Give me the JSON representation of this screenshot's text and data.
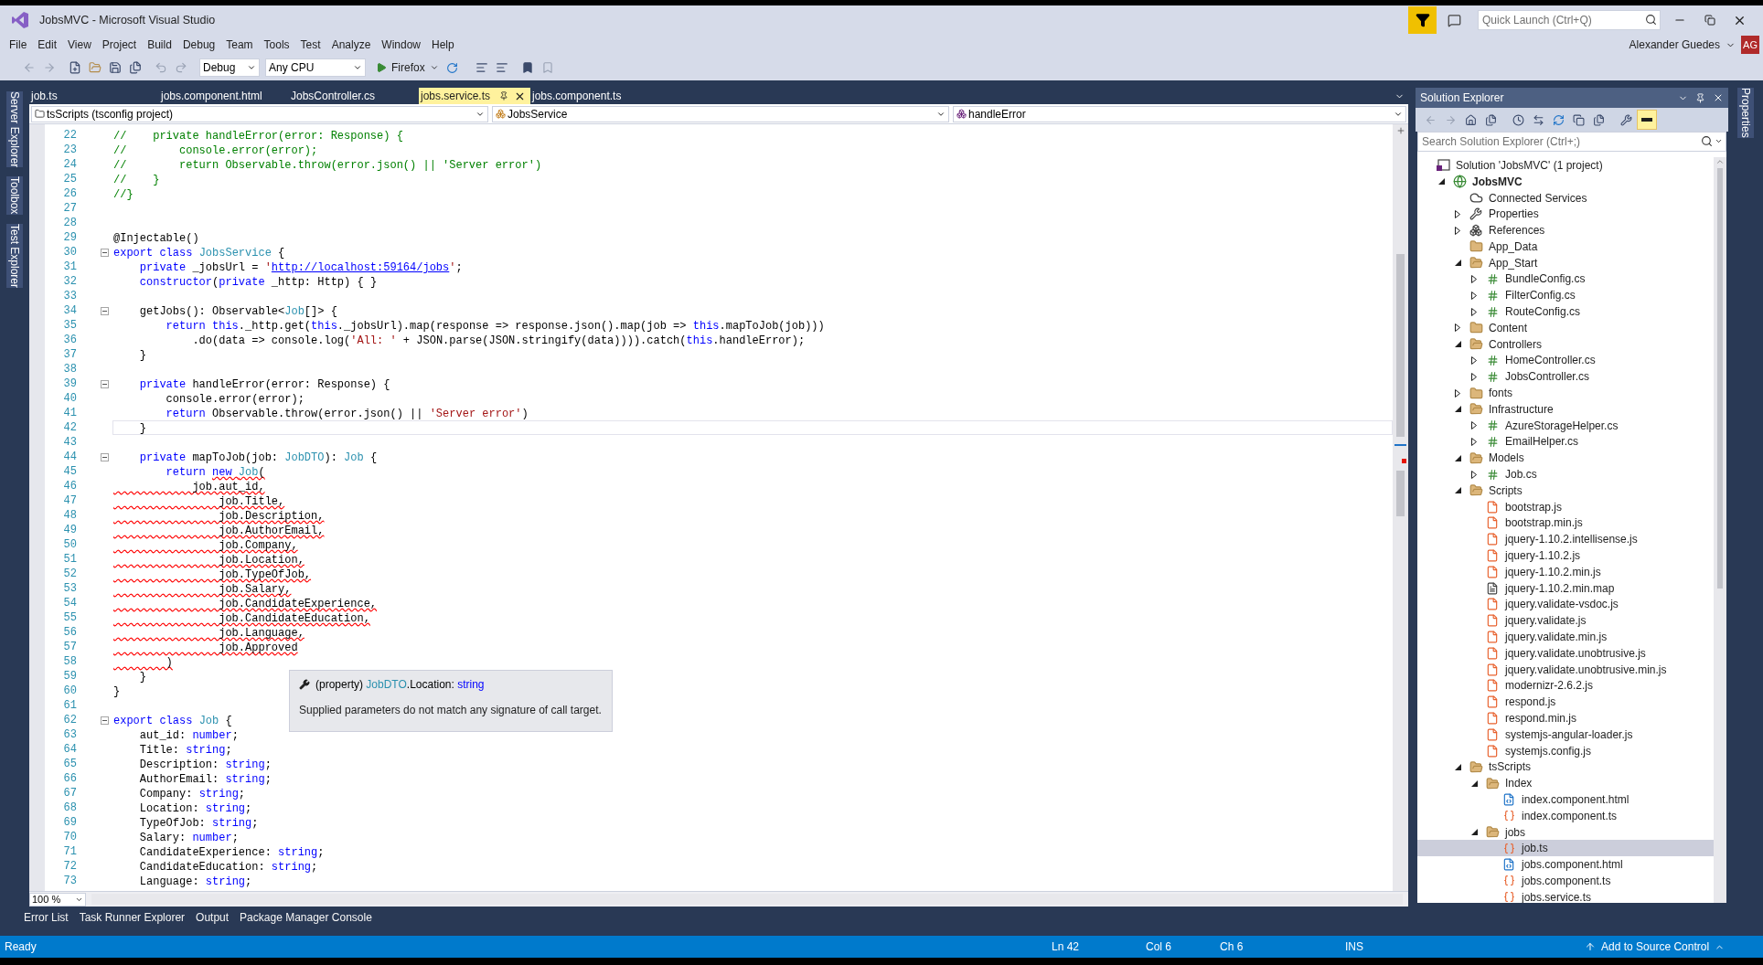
{
  "window": {
    "title": "JobsMVC - Microsoft Visual Studio"
  },
  "quick_launch": {
    "placeholder": "Quick Launch (Ctrl+Q)"
  },
  "menu": [
    "File",
    "Edit",
    "View",
    "Project",
    "Build",
    "Debug",
    "Team",
    "Tools",
    "Test",
    "Analyze",
    "Window",
    "Help"
  ],
  "account": {
    "name": "Alexander Guedes",
    "initials": "AG"
  },
  "toolbar": {
    "configuration": "Debug",
    "platform": "Any CPU",
    "run_target": "Firefox"
  },
  "left_tool_tabs": [
    "Server Explorer",
    "Toolbox",
    "Test Explorer"
  ],
  "right_tool_tabs": [
    "Properties"
  ],
  "document_tabs": [
    {
      "label": "job.ts",
      "selected": false
    },
    {
      "label": "jobs.component.html",
      "selected": false
    },
    {
      "label": "JobsController.cs",
      "selected": false
    },
    {
      "label": "jobs.service.ts",
      "selected": true
    },
    {
      "label": "jobs.component.ts",
      "selected": false
    }
  ],
  "navigation_bar": {
    "project": "tsScripts (tsconfig project)",
    "type": "JobsService",
    "member": "handleError"
  },
  "editor": {
    "lines": [
      {
        "n": "22",
        "fold": false,
        "current": false,
        "segs": [
          {
            "text": "//    private handleError(error: Response) {",
            "kind": "comment"
          }
        ]
      },
      {
        "n": "23",
        "fold": false,
        "current": false,
        "segs": [
          {
            "text": "//        console.error(error);",
            "kind": "comment"
          }
        ]
      },
      {
        "n": "24",
        "fold": false,
        "current": false,
        "segs": [
          {
            "text": "//        return Observable.throw(error.json() || 'Server error')",
            "kind": "comment"
          }
        ]
      },
      {
        "n": "25",
        "fold": false,
        "current": false,
        "segs": [
          {
            "text": "//    }",
            "kind": "comment"
          }
        ]
      },
      {
        "n": "26",
        "fold": false,
        "current": false,
        "segs": [
          {
            "text": "//}",
            "kind": "comment"
          }
        ]
      },
      {
        "n": "27",
        "fold": false,
        "current": false
      },
      {
        "n": "28",
        "fold": false,
        "current": false
      },
      {
        "n": "29",
        "fold": false,
        "current": false,
        "segs": [
          {
            "text": "@Injectable()",
            "kind": "plain"
          }
        ]
      },
      {
        "n": "30",
        "fold": true,
        "current": false,
        "segs": [
          {
            "text": "export class ",
            "kind": "keyword"
          },
          {
            "text": "JobsService",
            "kind": "type"
          },
          {
            "text": " {",
            "kind": "plain"
          }
        ]
      },
      {
        "n": "31",
        "fold": false,
        "current": false,
        "segs": [
          {
            "text": "    private",
            "kind": "keyword"
          },
          {
            "text": " _jobsUrl = ",
            "kind": "plain"
          },
          {
            "text": "'",
            "kind": "string"
          },
          {
            "text": "http://localhost:59164/jobs",
            "kind": "link"
          },
          {
            "text": "'",
            "kind": "string"
          },
          {
            "text": ";",
            "kind": "plain"
          }
        ]
      },
      {
        "n": "32",
        "fold": false,
        "current": false,
        "segs": [
          {
            "text": "    constructor",
            "kind": "keyword"
          },
          {
            "text": "(",
            "kind": "plain"
          },
          {
            "text": "private",
            "kind": "keyword"
          },
          {
            "text": " _http: Http) { }",
            "kind": "plain"
          }
        ]
      },
      {
        "n": "33",
        "fold": false,
        "current": false
      },
      {
        "n": "34",
        "fold": true,
        "current": false,
        "segs": [
          {
            "text": "    getJobs(): Observable<",
            "kind": "plain"
          },
          {
            "text": "Job",
            "kind": "type"
          },
          {
            "text": "[]> {",
            "kind": "plain"
          }
        ]
      },
      {
        "n": "35",
        "fold": false,
        "current": false,
        "segs": [
          {
            "text": "        return this",
            "kind": "keyword"
          },
          {
            "text": "._http.get(",
            "kind": "plain"
          },
          {
            "text": "this",
            "kind": "keyword"
          },
          {
            "text": "._jobsUrl).map(response => response.json().map(job => ",
            "kind": "plain"
          },
          {
            "text": "this",
            "kind": "keyword"
          },
          {
            "text": ".mapToJob(job)))",
            "kind": "plain"
          }
        ]
      },
      {
        "n": "36",
        "fold": false,
        "current": false,
        "segs": [
          {
            "text": "            .do(data => console.log(",
            "kind": "plain"
          },
          {
            "text": "'All: '",
            "kind": "string"
          },
          {
            "text": " + JSON.parse(JSON.stringify(data)))).catch(",
            "kind": "plain"
          },
          {
            "text": "this",
            "kind": "keyword"
          },
          {
            "text": ".handleError);",
            "kind": "plain"
          }
        ]
      },
      {
        "n": "37",
        "fold": false,
        "current": false,
        "segs": [
          {
            "text": "    }",
            "kind": "plain"
          }
        ]
      },
      {
        "n": "38",
        "fold": false,
        "current": false
      },
      {
        "n": "39",
        "fold": true,
        "current": false,
        "segs": [
          {
            "text": "    private",
            "kind": "keyword"
          },
          {
            "text": " handleError(error: Response) {",
            "kind": "plain"
          }
        ]
      },
      {
        "n": "40",
        "fold": false,
        "current": false,
        "segs": [
          {
            "text": "        console.error(error);",
            "kind": "plain"
          }
        ]
      },
      {
        "n": "41",
        "fold": false,
        "current": false,
        "segs": [
          {
            "text": "        return",
            "kind": "keyword"
          },
          {
            "text": " Observable.throw(error.json() || ",
            "kind": "plain"
          },
          {
            "text": "'Server error'",
            "kind": "string"
          },
          {
            "text": ")",
            "kind": "plain"
          }
        ]
      },
      {
        "n": "42",
        "fold": false,
        "current": true,
        "segs": [
          {
            "text": "    }",
            "kind": "plain"
          }
        ]
      },
      {
        "n": "43",
        "fold": false,
        "current": false
      },
      {
        "n": "44",
        "fold": true,
        "current": false,
        "segs": [
          {
            "text": "    private",
            "kind": "keyword"
          },
          {
            "text": " mapToJob(job: ",
            "kind": "plain"
          },
          {
            "text": "JobDTO",
            "kind": "type"
          },
          {
            "text": "): ",
            "kind": "plain"
          },
          {
            "text": "Job",
            "kind": "type"
          },
          {
            "text": " {",
            "kind": "plain"
          }
        ]
      },
      {
        "n": "45",
        "fold": false,
        "current": false,
        "segs": [
          {
            "text": "        return ",
            "kind": "keyword"
          },
          {
            "text": "new ",
            "kind": "keyword",
            "error": true
          },
          {
            "text": "Job",
            "kind": "type",
            "error": true
          },
          {
            "text": "(",
            "kind": "plain",
            "error": true
          }
        ]
      },
      {
        "n": "46",
        "fold": false,
        "current": false,
        "segs": [
          {
            "text": "            job.aut_id,",
            "kind": "plain",
            "error": true
          }
        ]
      },
      {
        "n": "47",
        "fold": false,
        "current": false,
        "segs": [
          {
            "text": "                job.Title,",
            "kind": "plain",
            "error": true
          }
        ]
      },
      {
        "n": "48",
        "fold": false,
        "current": false,
        "segs": [
          {
            "text": "                job.Description,",
            "kind": "plain",
            "error": true
          }
        ]
      },
      {
        "n": "49",
        "fold": false,
        "current": false,
        "segs": [
          {
            "text": "                job.AuthorEmail,",
            "kind": "plain",
            "error": true
          }
        ]
      },
      {
        "n": "50",
        "fold": false,
        "current": false,
        "segs": [
          {
            "text": "                job.Company,",
            "kind": "plain",
            "error": true
          }
        ]
      },
      {
        "n": "51",
        "fold": false,
        "current": false,
        "segs": [
          {
            "text": "                job.Location,",
            "kind": "plain",
            "error": true
          }
        ]
      },
      {
        "n": "52",
        "fold": false,
        "current": false,
        "segs": [
          {
            "text": "                job.TypeOfJob,",
            "kind": "plain",
            "error": true
          }
        ]
      },
      {
        "n": "53",
        "fold": false,
        "current": false,
        "segs": [
          {
            "text": "                job.Salary,",
            "kind": "plain",
            "error": true
          }
        ]
      },
      {
        "n": "54",
        "fold": false,
        "current": false,
        "segs": [
          {
            "text": "                job.CandidateExperience,",
            "kind": "plain",
            "error": true
          }
        ]
      },
      {
        "n": "55",
        "fold": false,
        "current": false,
        "segs": [
          {
            "text": "                job.CandidateEducation,",
            "kind": "plain",
            "error": true
          }
        ]
      },
      {
        "n": "56",
        "fold": false,
        "current": false,
        "segs": [
          {
            "text": "                job.Language,",
            "kind": "plain",
            "error": true
          }
        ]
      },
      {
        "n": "57",
        "fold": false,
        "current": false,
        "segs": [
          {
            "text": "                job.Approved",
            "kind": "plain",
            "error": true
          }
        ]
      },
      {
        "n": "58",
        "fold": false,
        "current": false,
        "segs": [
          {
            "text": "        )",
            "kind": "plain",
            "error": true
          }
        ]
      },
      {
        "n": "59",
        "fold": false,
        "current": false,
        "segs": [
          {
            "text": "    }",
            "kind": "plain"
          }
        ]
      },
      {
        "n": "60",
        "fold": false,
        "current": false,
        "segs": [
          {
            "text": "}",
            "kind": "plain"
          }
        ]
      },
      {
        "n": "61",
        "fold": false,
        "current": false
      },
      {
        "n": "62",
        "fold": true,
        "current": false,
        "segs": [
          {
            "text": "export class ",
            "kind": "keyword"
          },
          {
            "text": "Job",
            "kind": "type"
          },
          {
            "text": " {",
            "kind": "plain"
          }
        ]
      },
      {
        "n": "63",
        "fold": false,
        "current": false,
        "segs": [
          {
            "text": "    aut_id: ",
            "kind": "plain"
          },
          {
            "text": "number",
            "kind": "keyword"
          },
          {
            "text": ";",
            "kind": "plain"
          }
        ]
      },
      {
        "n": "64",
        "fold": false,
        "current": false,
        "segs": [
          {
            "text": "    Title: ",
            "kind": "plain"
          },
          {
            "text": "string",
            "kind": "keyword"
          },
          {
            "text": ";",
            "kind": "plain"
          }
        ]
      },
      {
        "n": "65",
        "fold": false,
        "current": false,
        "segs": [
          {
            "text": "    Description: ",
            "kind": "plain"
          },
          {
            "text": "string",
            "kind": "keyword"
          },
          {
            "text": ";",
            "kind": "plain"
          }
        ]
      },
      {
        "n": "66",
        "fold": false,
        "current": false,
        "segs": [
          {
            "text": "    AuthorEmail: ",
            "kind": "plain"
          },
          {
            "text": "string",
            "kind": "keyword"
          },
          {
            "text": ";",
            "kind": "plain"
          }
        ]
      },
      {
        "n": "67",
        "fold": false,
        "current": false,
        "segs": [
          {
            "text": "    Company: ",
            "kind": "plain"
          },
          {
            "text": "string",
            "kind": "keyword"
          },
          {
            "text": ";",
            "kind": "plain"
          }
        ]
      },
      {
        "n": "68",
        "fold": false,
        "current": false,
        "segs": [
          {
            "text": "    Location: ",
            "kind": "plain"
          },
          {
            "text": "string",
            "kind": "keyword"
          },
          {
            "text": ";",
            "kind": "plain"
          }
        ]
      },
      {
        "n": "69",
        "fold": false,
        "current": false,
        "segs": [
          {
            "text": "    TypeOfJob: ",
            "kind": "plain"
          },
          {
            "text": "string",
            "kind": "keyword"
          },
          {
            "text": ";",
            "kind": "plain"
          }
        ]
      },
      {
        "n": "70",
        "fold": false,
        "current": false,
        "segs": [
          {
            "text": "    Salary: ",
            "kind": "plain"
          },
          {
            "text": "number",
            "kind": "keyword"
          },
          {
            "text": ";",
            "kind": "plain"
          }
        ]
      },
      {
        "n": "71",
        "fold": false,
        "current": false,
        "segs": [
          {
            "text": "    CandidateExperience: ",
            "kind": "plain"
          },
          {
            "text": "string",
            "kind": "keyword"
          },
          {
            "text": ";",
            "kind": "plain"
          }
        ]
      },
      {
        "n": "72",
        "fold": false,
        "current": false,
        "segs": [
          {
            "text": "    CandidateEducation: ",
            "kind": "plain"
          },
          {
            "text": "string",
            "kind": "keyword"
          },
          {
            "text": ";",
            "kind": "plain"
          }
        ]
      },
      {
        "n": "73",
        "fold": false,
        "current": false,
        "segs": [
          {
            "text": "    Language: ",
            "kind": "plain"
          },
          {
            "text": "string",
            "kind": "keyword"
          },
          {
            "text": ";",
            "kind": "plain"
          }
        ]
      }
    ],
    "tooltip": {
      "segs": [
        {
          "text": "(property) ",
          "kind": "plain"
        },
        {
          "text": "JobDTO",
          "kind": "type"
        },
        {
          "text": ".Location: ",
          "kind": "plain"
        },
        {
          "text": "string",
          "kind": "keyword"
        }
      ],
      "message": "Supplied parameters do not match any signature of call target."
    },
    "zoom": "100 %"
  },
  "tool_windows": [
    "Error List",
    "Task Runner Explorer",
    "Output",
    "Package Manager Console"
  ],
  "solution_explorer": {
    "title": "Solution Explorer",
    "search": {
      "placeholder": "Search Solution Explorer (Ctrl+;)"
    },
    "tree": [
      {
        "label": "Solution 'JobsMVC' (1 project)",
        "kind": "solution",
        "selected": false,
        "children": [
          {
            "label": "JobsMVC",
            "kind": "project",
            "expanded": true,
            "selected": false,
            "children": [
              {
                "label": "Connected Services",
                "kind": "cloud",
                "selected": false
              },
              {
                "label": "Properties",
                "kind": "wrench",
                "expanded": false,
                "selected": false
              },
              {
                "label": "References",
                "kind": "references",
                "expanded": false,
                "selected": false
              },
              {
                "label": "App_Data",
                "kind": "folder",
                "selected": false
              },
              {
                "label": "App_Start",
                "kind": "folder",
                "expanded": true,
                "selected": false,
                "children": [
                  {
                    "label": "BundleConfig.cs",
                    "kind": "cs",
                    "expanded": false,
                    "selected": false
                  },
                  {
                    "label": "FilterConfig.cs",
                    "kind": "cs",
                    "expanded": false,
                    "selected": false
                  },
                  {
                    "label": "RouteConfig.cs",
                    "kind": "cs",
                    "expanded": false,
                    "selected": false
                  }
                ]
              },
              {
                "label": "Content",
                "kind": "folder",
                "expanded": false,
                "selected": false
              },
              {
                "label": "Controllers",
                "kind": "folder",
                "expanded": true,
                "selected": false,
                "children": [
                  {
                    "label": "HomeController.cs",
                    "kind": "cs",
                    "expanded": false,
                    "selected": false
                  },
                  {
                    "label": "JobsController.cs",
                    "kind": "cs",
                    "expanded": false,
                    "selected": false
                  }
                ]
              },
              {
                "label": "fonts",
                "kind": "folder",
                "expanded": false,
                "selected": false
              },
              {
                "label": "Infrastructure",
                "kind": "folder",
                "expanded": true,
                "selected": false,
                "children": [
                  {
                    "label": "AzureStorageHelper.cs",
                    "kind": "cs",
                    "expanded": false,
                    "selected": false
                  },
                  {
                    "label": "EmailHelper.cs",
                    "kind": "cs",
                    "expanded": false,
                    "selected": false
                  }
                ]
              },
              {
                "label": "Models",
                "kind": "folder",
                "expanded": true,
                "selected": false,
                "children": [
                  {
                    "label": "Job.cs",
                    "kind": "cs",
                    "expanded": false,
                    "selected": false
                  }
                ]
              },
              {
                "label": "Scripts",
                "kind": "folder",
                "expanded": true,
                "selected": false,
                "children": [
                  {
                    "label": "bootstrap.js",
                    "kind": "js",
                    "selected": false
                  },
                  {
                    "label": "bootstrap.min.js",
                    "kind": "js",
                    "selected": false
                  },
                  {
                    "label": "jquery-1.10.2.intellisense.js",
                    "kind": "js",
                    "selected": false
                  },
                  {
                    "label": "jquery-1.10.2.js",
                    "kind": "js",
                    "selected": false
                  },
                  {
                    "label": "jquery-1.10.2.min.js",
                    "kind": "js",
                    "selected": false
                  },
                  {
                    "label": "jquery-1.10.2.min.map",
                    "kind": "text",
                    "selected": false
                  },
                  {
                    "label": "jquery.validate-vsdoc.js",
                    "kind": "js",
                    "selected": false
                  },
                  {
                    "label": "jquery.validate.js",
                    "kind": "js",
                    "selected": false
                  },
                  {
                    "label": "jquery.validate.min.js",
                    "kind": "js",
                    "selected": false
                  },
                  {
                    "label": "jquery.validate.unobtrusive.js",
                    "kind": "js",
                    "selected": false
                  },
                  {
                    "label": "jquery.validate.unobtrusive.min.js",
                    "kind": "js",
                    "selected": false
                  },
                  {
                    "label": "modernizr-2.6.2.js",
                    "kind": "js",
                    "selected": false
                  },
                  {
                    "label": "respond.js",
                    "kind": "js",
                    "selected": false
                  },
                  {
                    "label": "respond.min.js",
                    "kind": "js",
                    "selected": false
                  },
                  {
                    "label": "systemjs-angular-loader.js",
                    "kind": "js",
                    "selected": false
                  },
                  {
                    "label": "systemjs.config.js",
                    "kind": "js",
                    "selected": false
                  }
                ]
              },
              {
                "label": "tsScripts",
                "kind": "folder",
                "expanded": true,
                "selected": false,
                "children": [
                  {
                    "label": "Index",
                    "kind": "folder",
                    "expanded": true,
                    "selected": false,
                    "children": [
                      {
                        "label": "index.component.html",
                        "kind": "html",
                        "selected": false
                      },
                      {
                        "label": "index.component.ts",
                        "kind": "ts",
                        "selected": false
                      }
                    ]
                  },
                  {
                    "label": "jobs",
                    "kind": "folder",
                    "expanded": true,
                    "selected": false,
                    "children": [
                      {
                        "label": "job.ts",
                        "kind": "ts",
                        "selected": true
                      },
                      {
                        "label": "jobs.component.html",
                        "kind": "html",
                        "selected": false
                      },
                      {
                        "label": "jobs.component.ts",
                        "kind": "ts",
                        "selected": false
                      },
                      {
                        "label": "jobs.service.ts",
                        "kind": "ts",
                        "selected": false
                      }
                    ]
                  }
                ]
              }
            ]
          }
        ]
      }
    ]
  },
  "status_bar": {
    "message": "Ready",
    "line": "Ln 42",
    "column": "Col 6",
    "char": "Ch 6",
    "mode": "INS",
    "source_control": "Add to Source Control"
  }
}
